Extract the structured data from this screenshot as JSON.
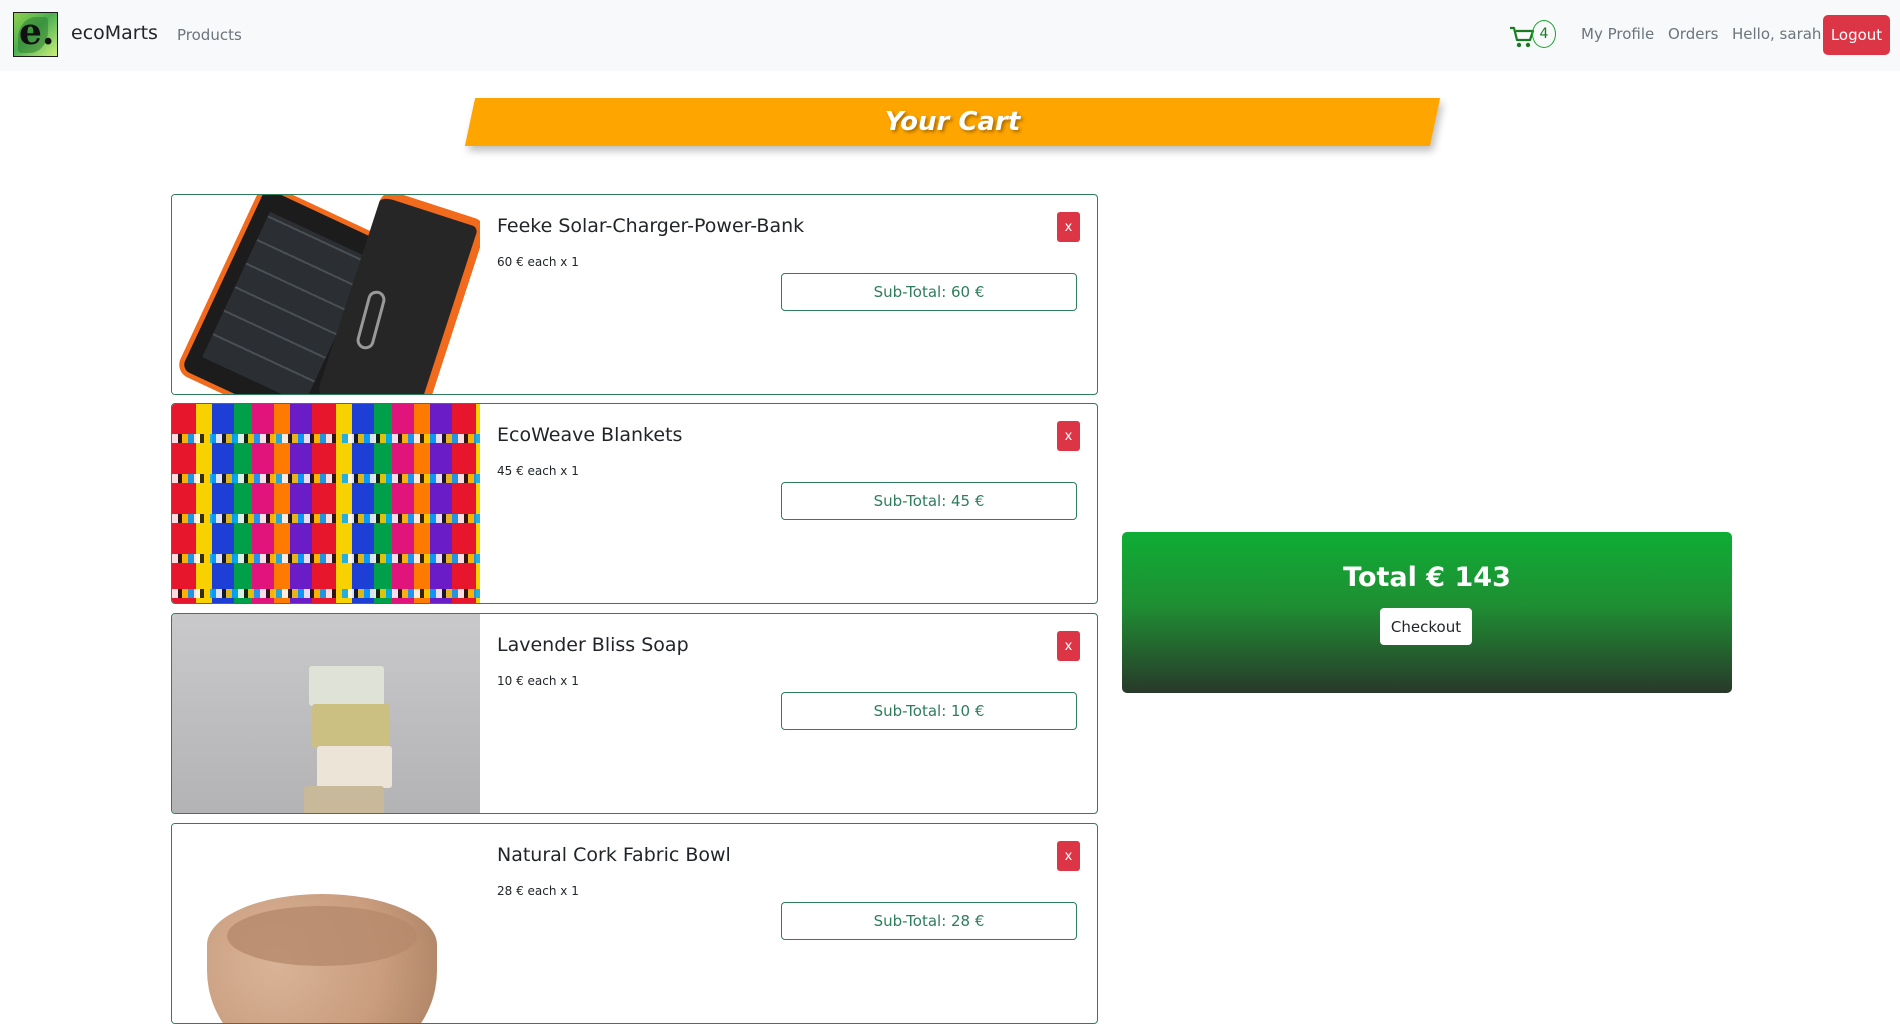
{
  "navbar": {
    "brand": "ecoMarts",
    "products_link": "Products",
    "cart_count": "4",
    "profile_link": "My Profile",
    "orders_link": "Orders",
    "greeting": "Hello, sarah",
    "logout_label": "Logout"
  },
  "page": {
    "title": "Your Cart"
  },
  "cart": {
    "items": [
      {
        "name": "Feeke Solar-Charger-Power-Bank",
        "price_line": "60 € each x 1",
        "subtotal": "Sub-Total: 60 €",
        "remove_label": "x"
      },
      {
        "name": "EcoWeave Blankets",
        "price_line": "45 € each x 1",
        "subtotal": "Sub-Total: 45 €",
        "remove_label": "x"
      },
      {
        "name": "Lavender Bliss Soap",
        "price_line": "10 € each x 1",
        "subtotal": "Sub-Total: 10 €",
        "remove_label": "x"
      },
      {
        "name": "Natural Cork Fabric Bowl",
        "price_line": "28 € each x 1",
        "subtotal": "Sub-Total: 28 €",
        "remove_label": "x"
      }
    ]
  },
  "summary": {
    "total": "Total € 143",
    "checkout_label": "Checkout"
  },
  "colors": {
    "accent_orange": "#ffa500",
    "danger": "#dc3545",
    "border_green": "#2e7d5b",
    "total_gradient_top": "#0ead34",
    "total_gradient_bottom": "#28392a"
  }
}
